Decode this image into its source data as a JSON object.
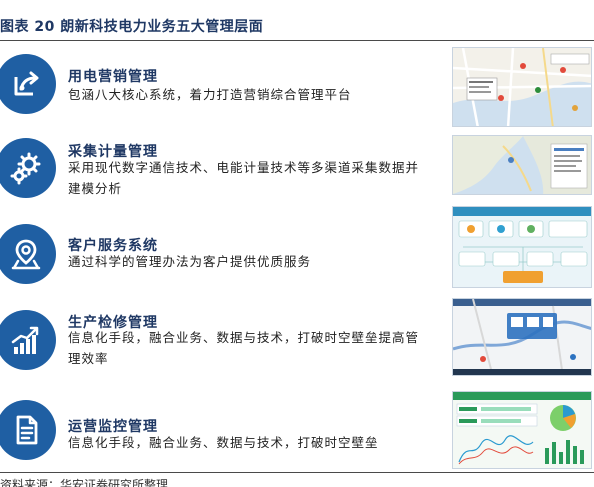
{
  "figure": {
    "title": "图表 20 朗新科技电力业务五大管理层面",
    "source": "资料来源：华安证券研究所整理"
  },
  "items": [
    {
      "title": "用电营销管理",
      "description": "包涵八大核心系统，着力打造营销综合管理平台",
      "icon": "share-arrows-icon"
    },
    {
      "title": "采集计量管理",
      "description": "采用现代数字通信技术、电能计量技术等多渠道采集数据并建模分析",
      "icon": "gears-icon"
    },
    {
      "title": "客户服务系统",
      "description": "通过科学的管理办法为客户提供优质服务",
      "icon": "location-pin-icon"
    },
    {
      "title": "生产检修管理",
      "description": "信息化手段，融合业务、数据与技术，打破时空壁垒提高管理效率",
      "icon": "rising-chart-icon"
    },
    {
      "title": "运营监控管理",
      "description": "信息化手段，融合业务、数据与技术，打破时空壁垒",
      "icon": "document-icon"
    }
  ],
  "colors": {
    "accent": "#1f5fa3",
    "title": "#1f3864"
  }
}
